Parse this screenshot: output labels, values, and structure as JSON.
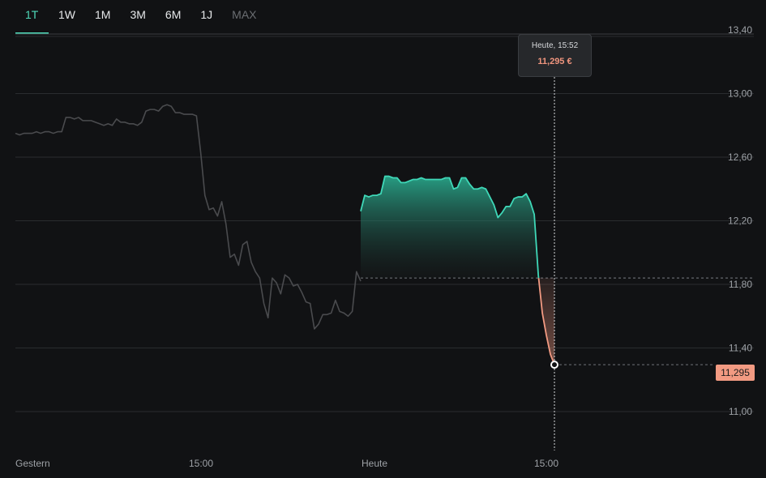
{
  "timeframes": [
    {
      "label": "1T",
      "state": "active"
    },
    {
      "label": "1W",
      "state": "normal"
    },
    {
      "label": "1M",
      "state": "normal"
    },
    {
      "label": "3M",
      "state": "normal"
    },
    {
      "label": "6M",
      "state": "normal"
    },
    {
      "label": "1J",
      "state": "normal"
    },
    {
      "label": "MAX",
      "state": "disabled"
    }
  ],
  "tooltip": {
    "time": "Heute, 15:52",
    "value": "11,295 €"
  },
  "current_price_label": "11,295",
  "colors": {
    "up": "#3fd8b8",
    "down": "#f29a82",
    "history": "#4a4b4e",
    "grid": "#2a2c2f",
    "tab_active": "#4fd9b9"
  },
  "chart_data": {
    "type": "line",
    "ylim": [
      10.8,
      13.4
    ],
    "y_ticks": [
      "13,40",
      "13,00",
      "12,60",
      "12,20",
      "11,80",
      "11,40",
      "11,00"
    ],
    "y_tick_values": [
      13.4,
      13.0,
      12.6,
      12.2,
      11.8,
      11.4,
      11.0
    ],
    "x_ticks": [
      "Gestern",
      "15:00",
      "Heute",
      "15:00"
    ],
    "reference_price": 11.84,
    "series": [
      {
        "role": "previous-day",
        "values": [
          12.75,
          12.74,
          12.75,
          12.75,
          12.75,
          12.76,
          12.75,
          12.76,
          12.76,
          12.75,
          12.76,
          12.76,
          12.85,
          12.85,
          12.84,
          12.85,
          12.83,
          12.83,
          12.83,
          12.82,
          12.81,
          12.8,
          12.81,
          12.8,
          12.84,
          12.82,
          12.82,
          12.81,
          12.81,
          12.8,
          12.82,
          12.89,
          12.9,
          12.9,
          12.89,
          12.92,
          12.93,
          12.92,
          12.88,
          12.88,
          12.87,
          12.87,
          12.87,
          12.86,
          12.63,
          12.36,
          12.27,
          12.28,
          12.23,
          12.32,
          12.18,
          11.97,
          11.99,
          11.92,
          12.05,
          12.07,
          11.94,
          11.88,
          11.84,
          11.68,
          11.59,
          11.84,
          11.81,
          11.74,
          11.86,
          11.84,
          11.79,
          11.8,
          11.75,
          11.69,
          11.68,
          11.52,
          11.55,
          11.61,
          11.61,
          11.62,
          11.7,
          11.63,
          11.62,
          11.6,
          11.63,
          11.88,
          11.82
        ]
      },
      {
        "role": "today",
        "values": [
          12.26,
          12.36,
          12.35,
          12.36,
          12.36,
          12.37,
          12.48,
          12.48,
          12.47,
          12.47,
          12.44,
          12.44,
          12.45,
          12.46,
          12.46,
          12.47,
          12.46,
          12.46,
          12.46,
          12.46,
          12.46,
          12.47,
          12.47,
          12.4,
          12.41,
          12.47,
          12.47,
          12.43,
          12.4,
          12.4,
          12.41,
          12.4,
          12.35,
          12.3,
          12.22,
          12.25,
          12.29,
          12.29,
          12.34,
          12.35,
          12.35,
          12.37,
          12.32,
          12.24,
          11.86,
          11.62,
          11.48,
          11.36,
          11.295
        ]
      }
    ]
  }
}
